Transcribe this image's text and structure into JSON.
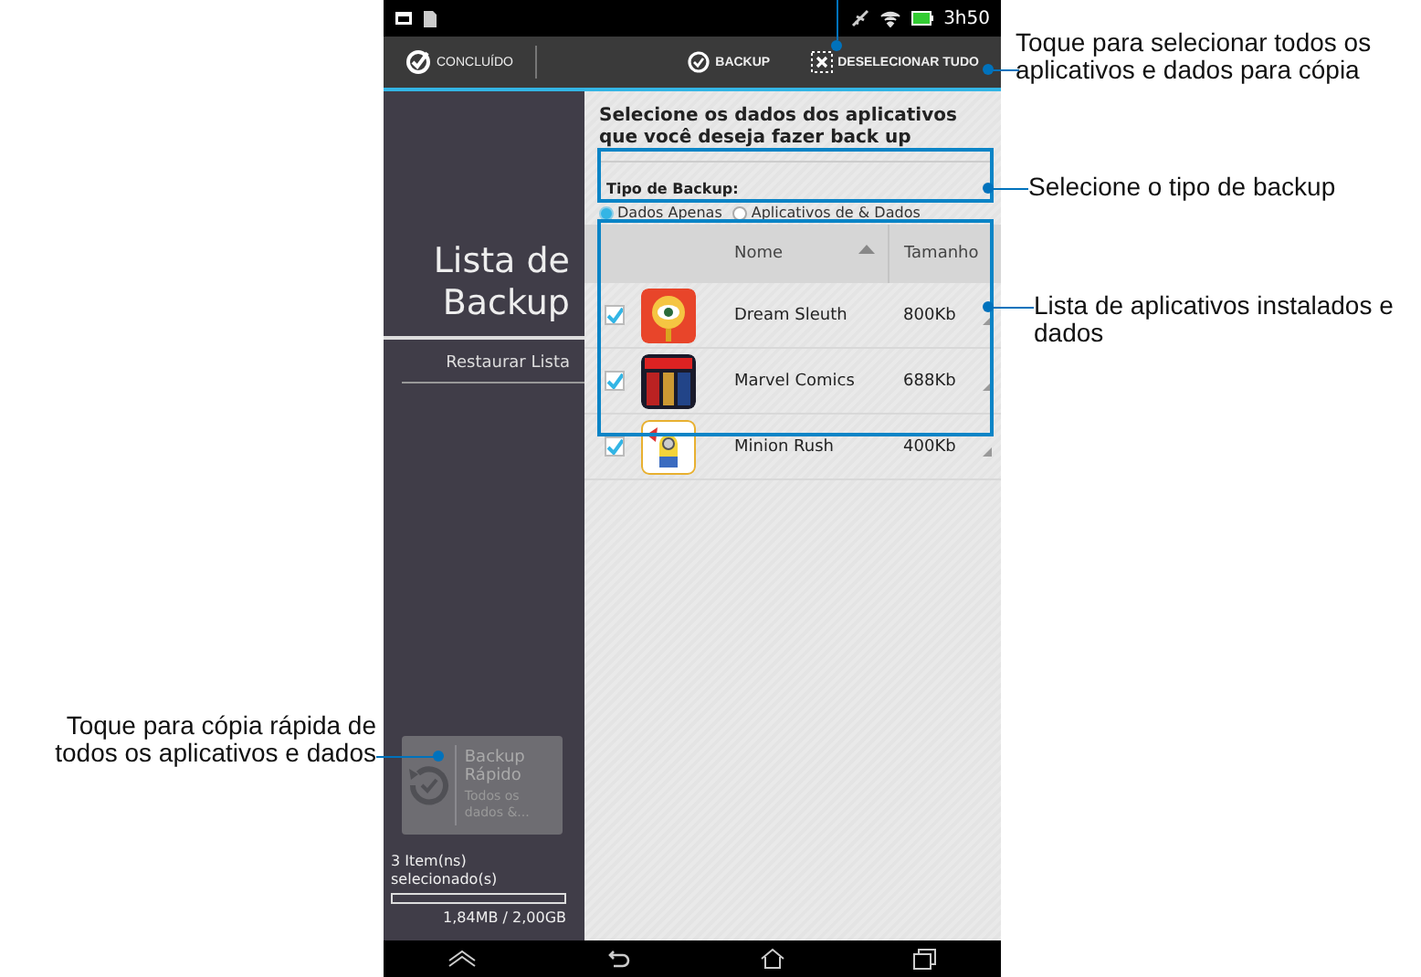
{
  "status_bar": {
    "time": "3h50"
  },
  "action_bar": {
    "done": "CONCLUÍDO",
    "backup": "BACKUP",
    "deselect_all": "DESELECIONAR TUDO"
  },
  "sidebar": {
    "title": "Lista de Backup",
    "restore": "Restaurar Lista",
    "quick_backup": {
      "title": "Backup Rápido",
      "subtitle": "Todos os dados &..."
    },
    "selection": "3 Item(ns) selecionado(s)",
    "storage": {
      "level": 0,
      "reading": "1,84MB / 2,00GB"
    }
  },
  "content": {
    "heading": "Selecione os dados dos aplicativos que você deseja fazer back up",
    "backup_type_label": "Tipo de Backup:",
    "backup_types": [
      {
        "label": "Dados Apenas",
        "selected": true
      },
      {
        "label": "Aplicativos de & Dados",
        "selected": false
      }
    ],
    "table": {
      "columns": [
        "Nome",
        "Tamanho"
      ],
      "rows": [
        {
          "name": "Dream Sleuth",
          "size": "800Kb",
          "checked": true
        },
        {
          "name": "Marvel Comics",
          "size": "688Kb",
          "checked": true
        },
        {
          "name": "Minion Rush",
          "size": "400Kb",
          "checked": true
        }
      ]
    }
  },
  "callouts": [
    {
      "text": "Toque para selecionar todos os aplicativos e dados para cópia"
    },
    {
      "text": "Selecione o tipo de backup"
    },
    {
      "text": "Lista de aplicativos instalados e dados"
    },
    {
      "text": "Toque para cópia rápida de todos os aplicativos e dados"
    }
  ]
}
